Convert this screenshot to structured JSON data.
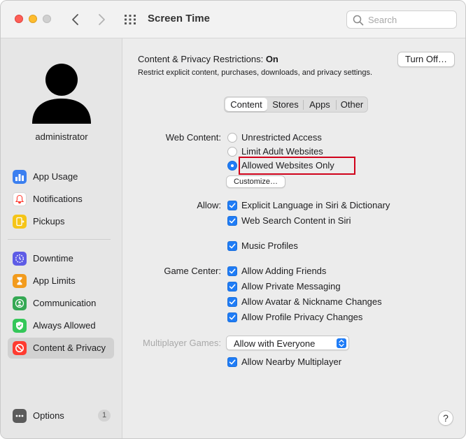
{
  "window": {
    "title": "Screen Time"
  },
  "search": {
    "placeholder": "Search"
  },
  "sidebar": {
    "username": "administrator",
    "items": [
      {
        "label": "App Usage",
        "icon": "app-usage-icon",
        "color": "#3b7ff0"
      },
      {
        "label": "Notifications",
        "icon": "notifications-bell-icon",
        "color": "#ffffff"
      },
      {
        "label": "Pickups",
        "icon": "pickups-icon",
        "color": "#f5c518"
      },
      {
        "label": "Downtime",
        "icon": "downtime-icon",
        "color": "#5e5ce6"
      },
      {
        "label": "App Limits",
        "icon": "app-limits-hourglass-icon",
        "color": "#f29b1d"
      },
      {
        "label": "Communication",
        "icon": "communication-icon",
        "color": "#34a853"
      },
      {
        "label": "Always Allowed",
        "icon": "always-allowed-check-icon",
        "color": "#34c759"
      },
      {
        "label": "Content & Privacy",
        "icon": "content-privacy-icon",
        "color": "#ff3b30",
        "selected": true
      }
    ],
    "options": {
      "label": "Options",
      "badge": "1"
    }
  },
  "main": {
    "header": {
      "title_prefix": "Content & Privacy Restrictions:",
      "status": "On",
      "description": "Restrict explicit content, purchases, downloads, and privacy settings.",
      "turn_off_label": "Turn Off…"
    },
    "tabs": [
      {
        "label": "Content",
        "active": true
      },
      {
        "label": "Stores",
        "active": false
      },
      {
        "label": "Apps",
        "active": false
      },
      {
        "label": "Other",
        "active": false
      }
    ],
    "web_content": {
      "label": "Web Content:",
      "options": [
        {
          "label": "Unrestricted Access",
          "selected": false
        },
        {
          "label": "Limit Adult Websites",
          "selected": false
        },
        {
          "label": "Allowed Websites Only",
          "selected": true
        }
      ],
      "customize_label": "Customize…"
    },
    "allow": {
      "label": "Allow:",
      "items": [
        {
          "label": "Explicit Language in Siri & Dictionary",
          "checked": true
        },
        {
          "label": "Web Search Content in Siri",
          "checked": true
        },
        {
          "label": "Music Profiles",
          "checked": true
        }
      ]
    },
    "game_center": {
      "label": "Game Center:",
      "items": [
        {
          "label": "Allow Adding Friends",
          "checked": true
        },
        {
          "label": "Allow Private Messaging",
          "checked": true
        },
        {
          "label": "Allow Avatar & Nickname Changes",
          "checked": true
        },
        {
          "label": "Allow Profile Privacy Changes",
          "checked": true
        }
      ]
    },
    "multiplayer": {
      "label": "Multiplayer Games:",
      "selected": "Allow with Everyone",
      "nearby_label": "Allow Nearby Multiplayer",
      "nearby_checked": true
    },
    "help_label": "?"
  },
  "colors": {
    "accent": "#1f7cf6",
    "highlight": "#d0021b"
  }
}
